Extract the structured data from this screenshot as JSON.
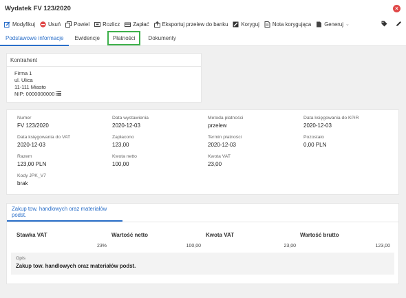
{
  "window": {
    "title": "Wydatek FV 123/2020",
    "close_icon": "close-icon"
  },
  "toolbar": {
    "items": [
      {
        "label": "Modyfikuj",
        "icon": "edit-icon"
      },
      {
        "label": "Usuń",
        "icon": "delete-icon"
      },
      {
        "label": "Powiel",
        "icon": "copy-icon"
      },
      {
        "label": "Rozlicz",
        "icon": "settle-icon"
      },
      {
        "label": "Zapłać",
        "icon": "pay-icon"
      },
      {
        "label": "Eksportuj przelew do banku",
        "icon": "export-icon"
      },
      {
        "label": "Koryguj",
        "icon": "correct-icon"
      },
      {
        "label": "Nota korygująca",
        "icon": "note-icon"
      },
      {
        "label": "Generuj",
        "icon": "generate-icon"
      }
    ],
    "right_icons": [
      "tag-icon",
      "pencil-icon"
    ]
  },
  "tabs": [
    {
      "label": "Podstawowe informacje",
      "active": true
    },
    {
      "label": "Ewidencje",
      "active": false
    },
    {
      "label": "Płatności",
      "active": false,
      "highlighted": true
    },
    {
      "label": "Dokumenty",
      "active": false
    }
  ],
  "kontrahent": {
    "header": "Kontrahent",
    "name": "Firma 1",
    "street": "ul. Ulica",
    "city": "11-111 Miasto",
    "nip": "NIP: 0000000000"
  },
  "info": {
    "numer": {
      "label": "Numer",
      "value": "FV 123/2020"
    },
    "data_wystawienia": {
      "label": "Data wystawienia",
      "value": "2020-12-03"
    },
    "metoda": {
      "label": "Metoda płatności",
      "value": "przelew"
    },
    "data_kpir": {
      "label": "Data księgowania do KPiR",
      "value": "2020-12-03"
    },
    "data_vat": {
      "label": "Data księgowania do VAT",
      "value": "2020-12-03"
    },
    "zaplacono": {
      "label": "Zapłacono",
      "value": "123,00"
    },
    "termin": {
      "label": "Termin płatności",
      "value": "2020-12-03"
    },
    "pozostalo": {
      "label": "Pozostało",
      "value": "0,00 PLN"
    },
    "razem": {
      "label": "Razem",
      "value": "123,00 PLN"
    },
    "netto": {
      "label": "Kwota netto",
      "value": "100,00"
    },
    "vat": {
      "label": "Kwota VAT",
      "value": "23,00"
    },
    "jpk": {
      "label": "Kody JPK_V7",
      "value": "brak"
    }
  },
  "positions": {
    "tab_label": "Zakup tow. handlowych oraz materiałów podst.",
    "headers": [
      "Stawka VAT",
      "Wartość netto",
      "Kwota VAT",
      "Wartość brutto"
    ],
    "row": [
      "23%",
      "100,00",
      "23,00",
      "123,00"
    ],
    "opis_label": "Opis",
    "opis_value": "Zakup tow. handlowych oraz materiałów podst."
  },
  "colors": {
    "accent": "#2a6fc9",
    "danger": "#e04848",
    "highlight": "#3db04a"
  }
}
